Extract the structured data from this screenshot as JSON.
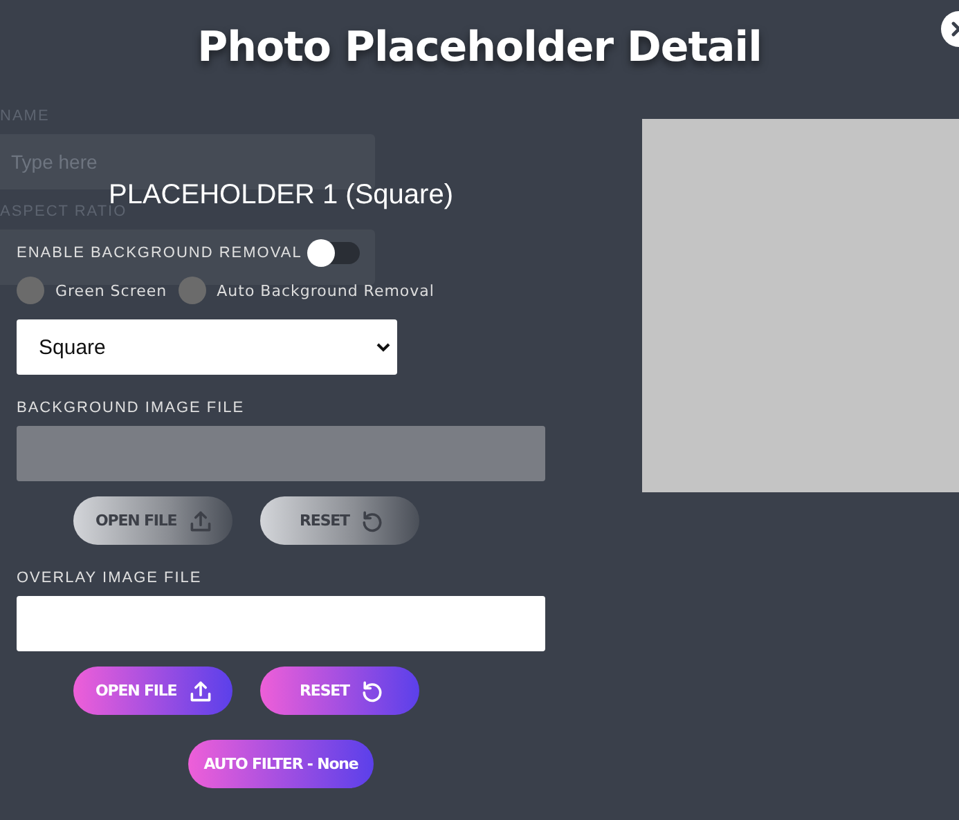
{
  "background": {
    "name_label": "NAME",
    "name_field": {
      "placeholder": "Type here"
    },
    "aspect_ratio_label": "ASPECT RATIO"
  },
  "dialog": {
    "title": "Photo Placeholder Detail"
  },
  "placeholder_heading": "PLACEHOLDER 1 (Square)",
  "background_removal": {
    "label": "ENABLE BACKGROUND REMOVAL",
    "on": false
  },
  "removal_modes": [
    {
      "label": "Green Screen",
      "selected": false
    },
    {
      "label": "Auto Background Removal",
      "selected": false
    }
  ],
  "shape_select": {
    "value": "Square"
  },
  "file_sections": [
    {
      "label": "BACKGROUND IMAGE FILE",
      "disabled": true,
      "buttons": [
        {
          "label": "OPEN FILE",
          "kind": "open"
        },
        {
          "label": "RESET",
          "kind": "reset"
        }
      ]
    },
    {
      "label": "OVERLAY IMAGE FILE",
      "disabled": false,
      "buttons": [
        {
          "label": "OPEN FILE",
          "kind": "open"
        },
        {
          "label": "RESET",
          "kind": "reset"
        }
      ]
    }
  ],
  "auto_filter": {
    "label": "AUTO FILTER - None"
  }
}
